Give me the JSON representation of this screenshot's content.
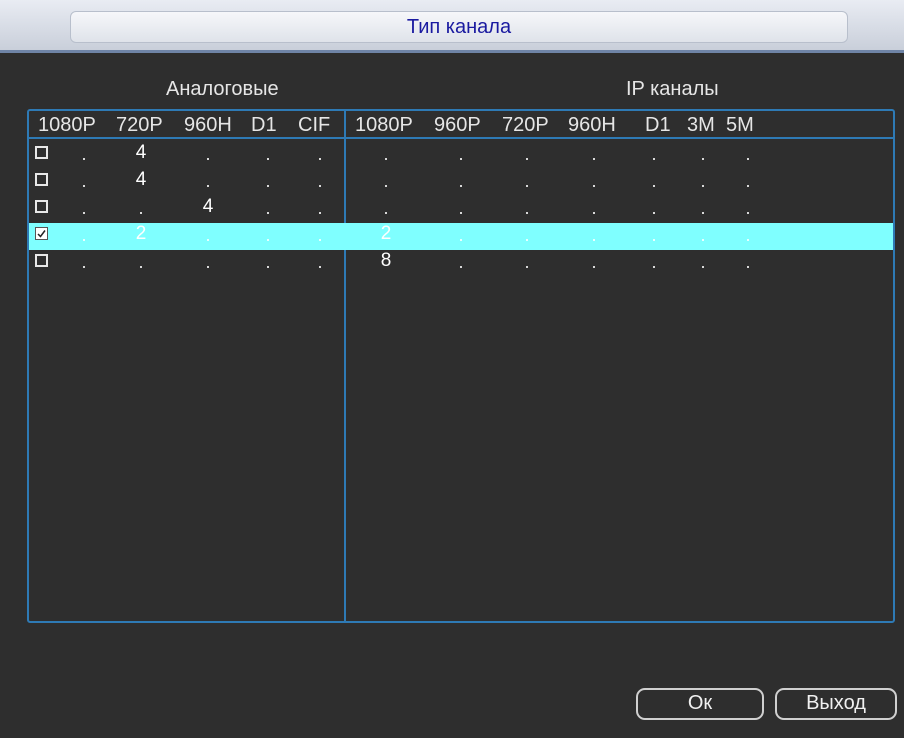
{
  "window": {
    "title": "Тип канала"
  },
  "sections": {
    "analog": "Аналоговые",
    "ip": "IP каналы"
  },
  "analog_columns": [
    "1080P",
    "720P",
    "960H",
    "D1",
    "CIF"
  ],
  "ip_columns": [
    "1080P",
    "960P",
    "720P",
    "960H",
    "D1",
    "3M",
    "5M"
  ],
  "rows": [
    {
      "checked": false,
      "analog": [
        ".",
        "4",
        ".",
        ".",
        "."
      ],
      "ip": [
        ".",
        ".",
        ".",
        ".",
        ".",
        ".",
        "."
      ]
    },
    {
      "checked": false,
      "analog": [
        ".",
        "4",
        ".",
        ".",
        "."
      ],
      "ip": [
        ".",
        ".",
        ".",
        ".",
        ".",
        ".",
        "."
      ]
    },
    {
      "checked": false,
      "analog": [
        ".",
        ".",
        "4",
        ".",
        "."
      ],
      "ip": [
        ".",
        ".",
        ".",
        ".",
        ".",
        ".",
        "."
      ]
    },
    {
      "checked": true,
      "analog": [
        ".",
        "2",
        ".",
        ".",
        "."
      ],
      "ip": [
        "2",
        ".",
        ".",
        ".",
        ".",
        ".",
        "."
      ]
    },
    {
      "checked": false,
      "analog": [
        ".",
        ".",
        ".",
        ".",
        "."
      ],
      "ip": [
        "8",
        ".",
        ".",
        ".",
        ".",
        ".",
        "."
      ]
    }
  ],
  "selected_row": 3,
  "colors": {
    "highlight": "#7fffff",
    "border": "#2e7ab5",
    "background": "#2e2e2e",
    "title_text": "#1a1aa0"
  },
  "buttons": {
    "ok": "Ок",
    "exit": "Выход"
  }
}
